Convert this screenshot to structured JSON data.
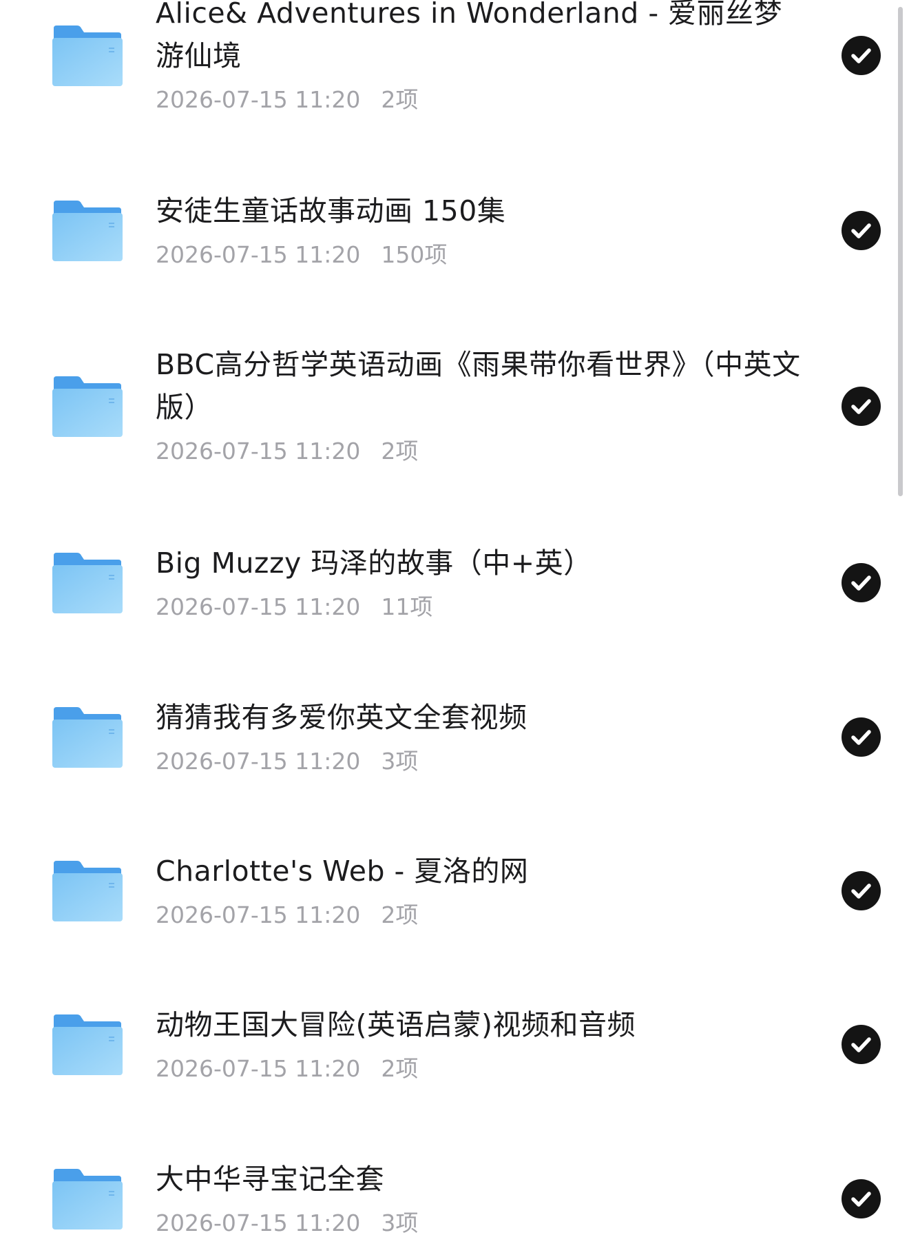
{
  "folders": [
    {
      "name": "Alice& Adventures in Wonderland - 爱丽丝梦游仙境",
      "date": "2026-07-15 11:20",
      "count": "2项",
      "selected": true
    },
    {
      "name": "安徒生童话故事动画 150集",
      "date": "2026-07-15 11:20",
      "count": "150项",
      "selected": true
    },
    {
      "name": "BBC高分哲学英语动画《雨果带你看世界》（中英文版）",
      "date": "2026-07-15 11:20",
      "count": "2项",
      "selected": true
    },
    {
      "name": "Big Muzzy 玛泽的故事（中+英）",
      "date": "2026-07-15 11:20",
      "count": "11项",
      "selected": true
    },
    {
      "name": "猜猜我有多爱你英文全套视频",
      "date": "2026-07-15 11:20",
      "count": "3项",
      "selected": true
    },
    {
      "name": "Charlotte's Web - 夏洛的网",
      "date": "2026-07-15 11:20",
      "count": "2项",
      "selected": true
    },
    {
      "name": "动物王国大冒险(英语启蒙)视频和音频",
      "date": "2026-07-15 11:20",
      "count": "2项",
      "selected": true
    },
    {
      "name": "大中华寻宝记全套",
      "date": "2026-07-15 11:20",
      "count": "3项",
      "selected": true
    }
  ],
  "icons": {
    "folder": "folder-icon",
    "selected": "checkmark-circle-icon"
  },
  "colors": {
    "folder_top": "#4a9fea",
    "folder_front": "#8fd0f7",
    "check_bg": "#141414",
    "title_text": "#1c1c1e",
    "meta_text": "#a3a3a8"
  }
}
